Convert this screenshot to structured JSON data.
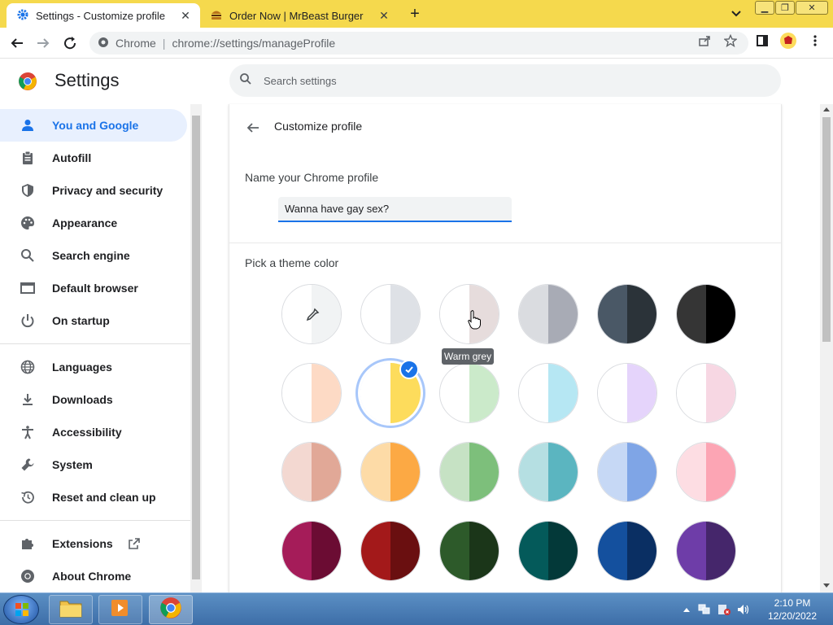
{
  "browser": {
    "tabs": [
      {
        "title": "Settings - Customize profile",
        "icon": "gear-icon",
        "active": true
      },
      {
        "title": "Order Now | MrBeast Burger",
        "icon": "burger-icon",
        "active": false
      }
    ],
    "new_tab": "+",
    "omnibox": {
      "chip": "Chrome",
      "url": "chrome://settings/manageProfile"
    }
  },
  "settings": {
    "title": "Settings",
    "search_placeholder": "Search settings"
  },
  "sidebar": {
    "items": [
      {
        "label": "You and Google",
        "icon": "person-icon",
        "selected": true
      },
      {
        "label": "Autofill",
        "icon": "clipboard-icon"
      },
      {
        "label": "Privacy and security",
        "icon": "shield-icon"
      },
      {
        "label": "Appearance",
        "icon": "palette-icon"
      },
      {
        "label": "Search engine",
        "icon": "search-icon"
      },
      {
        "label": "Default browser",
        "icon": "browser-icon"
      },
      {
        "label": "On startup",
        "icon": "power-icon"
      },
      {
        "label": "Languages",
        "icon": "globe-icon"
      },
      {
        "label": "Downloads",
        "icon": "download-icon"
      },
      {
        "label": "Accessibility",
        "icon": "accessibility-icon"
      },
      {
        "label": "System",
        "icon": "wrench-icon"
      },
      {
        "label": "Reset and clean up",
        "icon": "history-icon"
      },
      {
        "label": "Extensions",
        "icon": "puzzle-icon"
      },
      {
        "label": "About Chrome",
        "icon": "chrome-icon"
      }
    ]
  },
  "profile": {
    "page_title": "Customize profile",
    "name_label": "Name your Chrome profile",
    "name_value": "Wanna have gay sex?",
    "theme_label": "Pick a theme color",
    "tooltip": "Warm grey"
  },
  "theme_colors": [
    {
      "left": "#ffffff",
      "right": "#f1f3f4",
      "custom": true
    },
    {
      "left": "#ffffff",
      "right": "#dee1e6"
    },
    {
      "left": "#ffffff",
      "right": "#e6dcdc"
    },
    {
      "left": "#dadce0",
      "right": "#a8abb5"
    },
    {
      "left": "#4a5866",
      "right": "#2b3339"
    },
    {
      "left": "#353535",
      "right": "#000000"
    },
    {
      "left": "#ffffff",
      "right": "#fddac5"
    },
    {
      "left": "#ffffff",
      "right": "#fddc5c",
      "selected": true
    },
    {
      "left": "#ffffff",
      "right": "#cbeaca"
    },
    {
      "left": "#ffffff",
      "right": "#b6e7f3"
    },
    {
      "left": "#ffffff",
      "right": "#e5d4fb"
    },
    {
      "left": "#ffffff",
      "right": "#f7d7e3"
    },
    {
      "left": "#f3d8d1",
      "right": "#e1a897"
    },
    {
      "left": "#fddba7",
      "right": "#fca944"
    },
    {
      "left": "#c6e2c4",
      "right": "#7dbf7b"
    },
    {
      "left": "#b5dfe2",
      "right": "#5bb5c0"
    },
    {
      "left": "#c6d8f5",
      "right": "#7fa5e6"
    },
    {
      "left": "#fddde3",
      "right": "#fca5b4"
    },
    {
      "left": "#a51c59",
      "right": "#6b0c33"
    },
    {
      "left": "#a3191a",
      "right": "#6a0f10"
    },
    {
      "left": "#2d5a2a",
      "right": "#1b3619"
    },
    {
      "left": "#045a5a",
      "right": "#033939"
    },
    {
      "left": "#14509e",
      "right": "#0a2f63"
    },
    {
      "left": "#6e3da8",
      "right": "#45266b"
    }
  ],
  "taskbar": {
    "time": "2:10 PM",
    "date": "12/20/2022"
  }
}
